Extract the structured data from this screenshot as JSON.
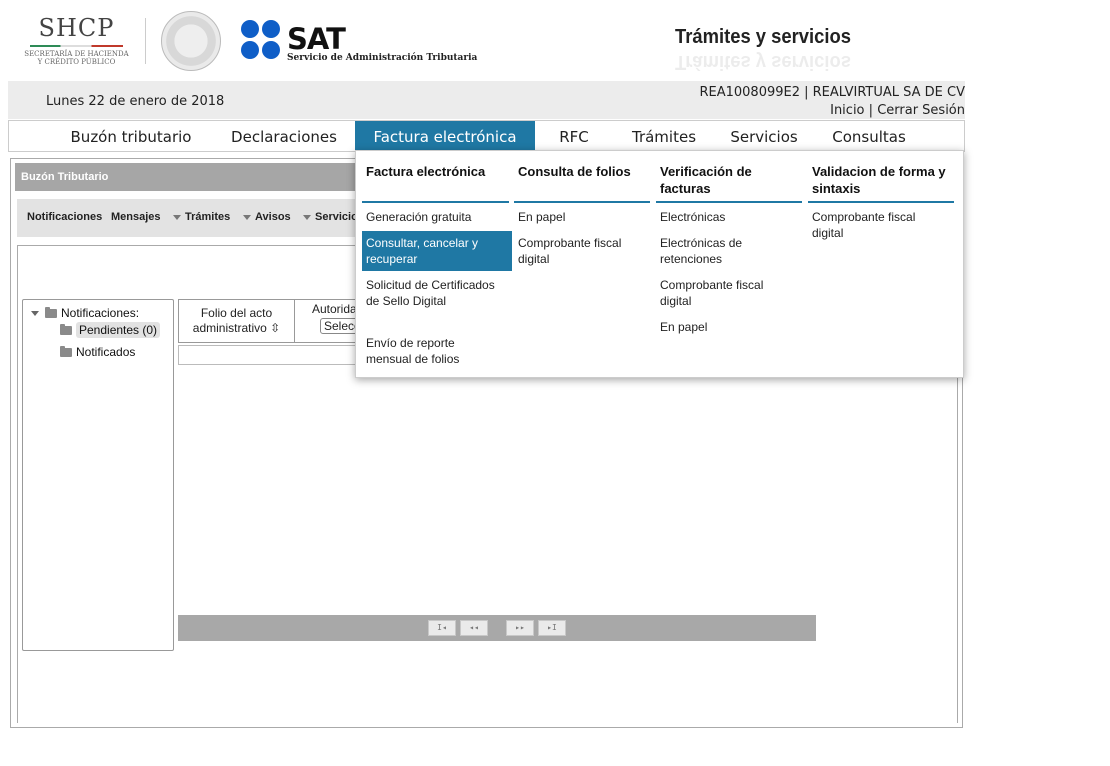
{
  "header": {
    "shcp_logo": "SHCP",
    "shcp_sub_1": "SECRETARÍA DE HACIENDA",
    "shcp_sub_2": "Y CRÉDITO PÚBLICO",
    "sat_logo": "SAT",
    "sat_sub": "Servicio de Administración Tributaria",
    "page_title": "Trámites y servicios"
  },
  "datebar": {
    "date": "Lunes 22 de enero de 2018",
    "user": "REA1008099E2 | REALVIRTUAL SA DE CV",
    "inicio": "Inicio",
    "sep": "|",
    "cerrar": "Cerrar Sesión"
  },
  "nav": {
    "items": [
      "Buzón tributario",
      "Declaraciones",
      "Factura electrónica",
      "RFC",
      "Trámites",
      "Servicios",
      "Consultas"
    ],
    "active_index": 2
  },
  "panel": {
    "title": "Buzón Tributario",
    "subnav": [
      "Notificaciones",
      "Mensajes",
      "Trámites",
      "Avisos",
      "Servicio"
    ]
  },
  "tree": {
    "root": "Notificaciones:",
    "children": [
      "Pendientes (0)",
      "Notificados"
    ]
  },
  "grid": {
    "col1_line1": "Folio del acto",
    "col1_line2": "administrativo",
    "sort_icon": "⇳",
    "col2": "Autorida",
    "col2_select": "Selecc"
  },
  "pager": {
    "first": "I◂",
    "prev": "◂◂",
    "next": "▸▸",
    "last": "▸I"
  },
  "dropdown": {
    "columns": [
      {
        "heading": "Factura electrónica",
        "items": [
          "Generación gratuita",
          "Consultar, cancelar y recuperar",
          "Solicitud de Certificados de Sello Digital",
          "Envío de reporte mensual de folios"
        ]
      },
      {
        "heading": "Consulta de folios",
        "items": [
          "En papel",
          "Comprobante fiscal digital"
        ]
      },
      {
        "heading": "Verificación de facturas",
        "items": [
          "Electrónicas",
          "Electrónicas de retenciones",
          "Comprobante fiscal digital",
          "En papel"
        ]
      },
      {
        "heading": "Validacion de forma y sintaxis",
        "items": [
          "Comprobante fiscal digital"
        ]
      }
    ],
    "highlighted": "Consultar, cancelar y recuperar"
  },
  "colors": {
    "accent": "#1f78a4",
    "sat_blue": "#0f5ec7",
    "panel_gray": "#a6a6a6"
  }
}
